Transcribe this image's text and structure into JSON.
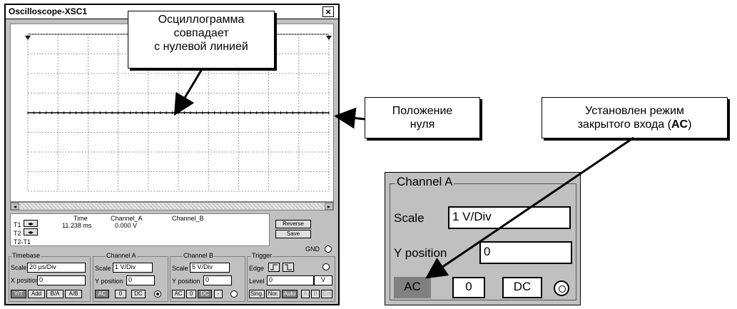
{
  "window": {
    "title": "Oscilloscope-XSC1",
    "close_glyph": "×"
  },
  "readout": {
    "row_labels": [
      "T1",
      "T2",
      "T2-T1"
    ],
    "col_headers": [
      "Time",
      "Channel_A",
      "Channel_B"
    ],
    "t1_time": "11.238 ms",
    "t1_channel_a": "0.000 V",
    "reverse_label": "Reverse",
    "save_label": "Save",
    "gnd_label": "GND"
  },
  "timebase": {
    "title": "Timebase",
    "scale_label": "Scale",
    "scale_value": "20 µs/Div",
    "xpos_label": "X position",
    "xpos_value": "0",
    "modes": [
      "Y/T",
      "Add",
      "B/A",
      "A/B"
    ]
  },
  "channel_a": {
    "title": "Channel A",
    "scale_label": "Scale",
    "scale_value": "1  V/Div",
    "ypos_label": "Y position",
    "ypos_value": "0",
    "coupling": [
      "AC",
      "0",
      "DC"
    ]
  },
  "channel_b": {
    "title": "Channel B",
    "scale_label": "Scale",
    "scale_value": "5  V/Div",
    "ypos_label": "Y position",
    "ypos_value": "0",
    "coupling": [
      "AC",
      "0",
      "DC",
      "-"
    ]
  },
  "trigger": {
    "title": "Trigger",
    "edge_label": "Edge",
    "level_label": "Level",
    "level_value": "0",
    "level_unit": "V",
    "modes": [
      "Sing.",
      "Nor.",
      "Auto"
    ],
    "sources": [
      "A",
      "B",
      "Ext"
    ]
  },
  "callouts": {
    "top": [
      "Осциллограмма",
      "совпадает",
      "с нулевой линией"
    ],
    "zero": [
      "Положение",
      "нуля"
    ],
    "ac_line1": "Установлен режим",
    "ac_line2_prefix": "закрытого входа (",
    "ac_line2_bold": "AC",
    "ac_line2_suffix": ")"
  },
  "zoom": {
    "title": "Channel A",
    "scale_label": "Scale",
    "scale_value": "1  V/Div",
    "ypos_label": "Y position",
    "ypos_value": "0",
    "ac_label": "AC",
    "zero_label": "0",
    "dc_label": "DC"
  },
  "colors": {
    "window_bg": "#c0c0c0",
    "screen_bg": "#ffffff",
    "trace": "#000000",
    "grid": "#808080"
  }
}
